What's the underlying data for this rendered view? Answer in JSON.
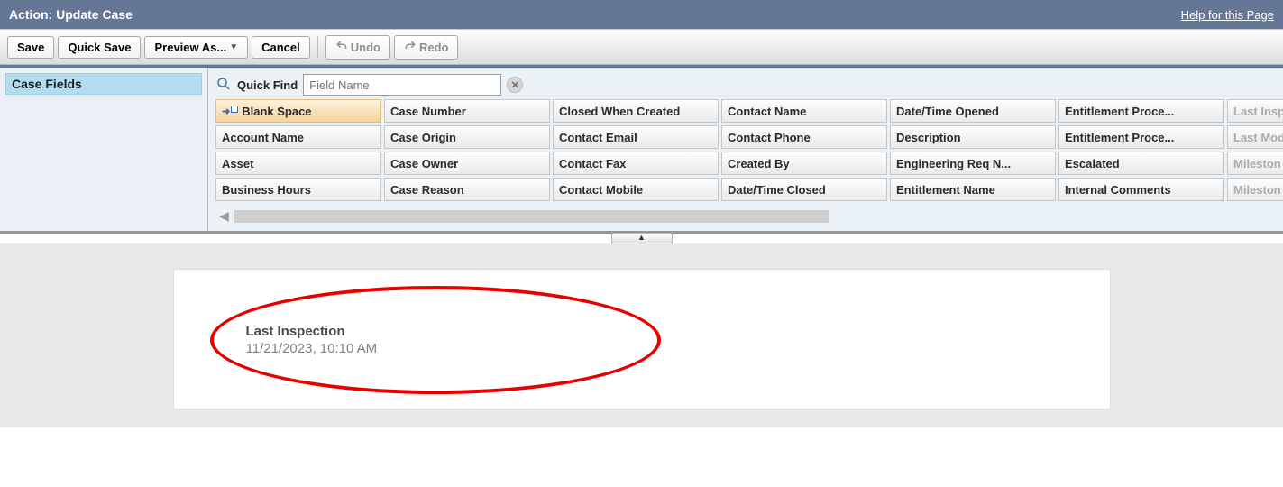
{
  "header": {
    "title": "Action: Update Case",
    "help_link": "Help for this Page"
  },
  "toolbar": {
    "save": "Save",
    "quick_save": "Quick Save",
    "preview_as": "Preview As...",
    "cancel": "Cancel",
    "undo": "Undo",
    "redo": "Redo"
  },
  "sidebar": {
    "item_label": "Case Fields"
  },
  "quickfind": {
    "label": "Quick Find",
    "placeholder": "Field Name"
  },
  "fields": {
    "col0": [
      "Blank Space",
      "Account Name",
      "Asset",
      "Business Hours"
    ],
    "col1": [
      "Case Number",
      "Case Origin",
      "Case Owner",
      "Case Reason"
    ],
    "col2": [
      "Closed When Created",
      "Contact Email",
      "Contact Fax",
      "Contact Mobile"
    ],
    "col3": [
      "Contact Name",
      "Contact Phone",
      "Created By",
      "Date/Time Closed"
    ],
    "col4": [
      "Date/Time Opened",
      "Description",
      "Engineering Req N...",
      "Entitlement Name"
    ],
    "col5": [
      "Entitlement Proce...",
      "Entitlement Proce...",
      "Escalated",
      "Internal Comments"
    ],
    "col6": [
      "Last Insp",
      "Last Mod",
      "Mileston",
      "Mileston"
    ]
  },
  "preview": {
    "field_label": "Last Inspection",
    "field_value": "11/21/2023, 10:10 AM"
  }
}
